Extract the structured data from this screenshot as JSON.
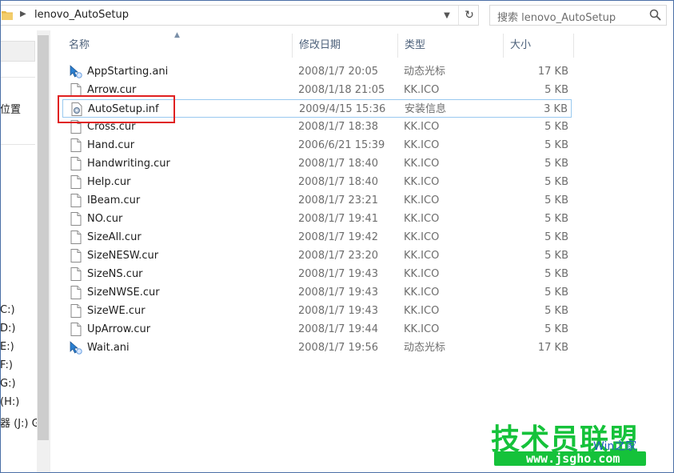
{
  "address": {
    "path": "lenovo_AutoSetup",
    "search_placeholder": "搜索 lenovo_AutoSetup"
  },
  "nav": {
    "items": [
      {
        "label": "位置"
      },
      {
        "label": "C:)"
      },
      {
        "label": "D:)"
      },
      {
        "label": "E:)"
      },
      {
        "label": "F:)"
      },
      {
        "label": "G:)"
      },
      {
        "label": " (H:)"
      },
      {
        "label": "器 (J:) G"
      }
    ]
  },
  "columns": {
    "name": "名称",
    "date": "修改日期",
    "type": "类型",
    "size": "大小"
  },
  "files": [
    {
      "name": "AppStarting.ani",
      "date": "2008/1/7 20:05",
      "type": "动态光标",
      "size": "17 KB",
      "icon": "animated-cursor-icon"
    },
    {
      "name": "Arrow.cur",
      "date": "2008/1/18 21:05",
      "type": "KK.ICO",
      "size": "5 KB",
      "icon": "file-icon"
    },
    {
      "name": "AutoSetup.inf",
      "date": "2009/4/15 15:36",
      "type": "安装信息",
      "size": "3 KB",
      "icon": "setup-info-icon"
    },
    {
      "name": "Cross.cur",
      "date": "2008/1/7 18:38",
      "type": "KK.ICO",
      "size": "5 KB",
      "icon": "file-icon"
    },
    {
      "name": "Hand.cur",
      "date": "2006/6/21 15:39",
      "type": "KK.ICO",
      "size": "5 KB",
      "icon": "file-icon"
    },
    {
      "name": "Handwriting.cur",
      "date": "2008/1/7 18:40",
      "type": "KK.ICO",
      "size": "5 KB",
      "icon": "file-icon"
    },
    {
      "name": "Help.cur",
      "date": "2008/1/7 18:40",
      "type": "KK.ICO",
      "size": "5 KB",
      "icon": "file-icon"
    },
    {
      "name": "IBeam.cur",
      "date": "2008/1/7 23:21",
      "type": "KK.ICO",
      "size": "5 KB",
      "icon": "file-icon"
    },
    {
      "name": "NO.cur",
      "date": "2008/1/7 19:41",
      "type": "KK.ICO",
      "size": "5 KB",
      "icon": "file-icon"
    },
    {
      "name": "SizeAll.cur",
      "date": "2008/1/7 19:42",
      "type": "KK.ICO",
      "size": "5 KB",
      "icon": "file-icon"
    },
    {
      "name": "SizeNESW.cur",
      "date": "2008/1/7 23:20",
      "type": "KK.ICO",
      "size": "5 KB",
      "icon": "file-icon"
    },
    {
      "name": "SizeNS.cur",
      "date": "2008/1/7 19:43",
      "type": "KK.ICO",
      "size": "5 KB",
      "icon": "file-icon"
    },
    {
      "name": "SizeNWSE.cur",
      "date": "2008/1/7 19:43",
      "type": "KK.ICO",
      "size": "5 KB",
      "icon": "file-icon"
    },
    {
      "name": "SizeWE.cur",
      "date": "2008/1/7 19:43",
      "type": "KK.ICO",
      "size": "5 KB",
      "icon": "file-icon"
    },
    {
      "name": "UpArrow.cur",
      "date": "2008/1/7 19:44",
      "type": "KK.ICO",
      "size": "5 KB",
      "icon": "file-icon"
    },
    {
      "name": "Wait.ani",
      "date": "2008/1/7 19:56",
      "type": "动态光标",
      "size": "17 KB",
      "icon": "animated-cursor-icon"
    }
  ],
  "selected_index": 2,
  "watermark": {
    "title": "技术员联盟",
    "url": "www.jsgho.com",
    "side": "Win之家"
  },
  "colors": {
    "accent_selection": "#99c9ef",
    "highlight_box": "#e02020",
    "watermark_green": "#15c23a"
  }
}
